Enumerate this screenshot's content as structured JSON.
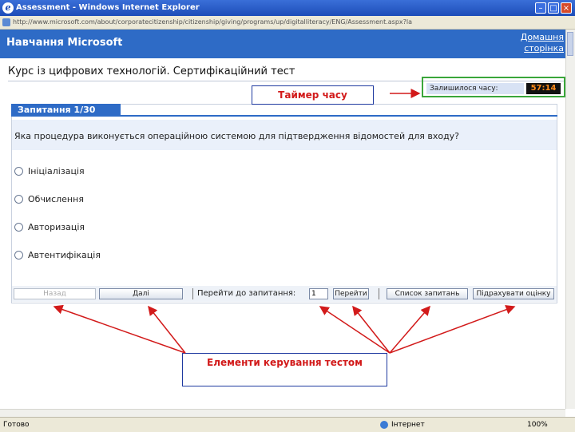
{
  "window": {
    "title": "Assessment - Windows Internet Explorer",
    "url": "http://www.microsoft.com/about/corporatecitizenship/citizenship/giving/programs/up/digitalliteracy/ENG/Assessment.aspx?lang=uk&ver=sesae"
  },
  "site": {
    "title": "Навчання Microsoft",
    "home_link": "Домашня сторінка"
  },
  "course": {
    "title": "Курс із цифрових технологій. Сертифікаційний тест"
  },
  "timer": {
    "label": "Залишилося часу:",
    "value": "57:14"
  },
  "question": {
    "header": "Запитання 1/30",
    "text": "Яка процедура виконується операційною системою для підтвердження відомостей для входу?",
    "answers": [
      "Ініціалізація",
      "Обчислення",
      "Авторизація",
      "Автентифікація"
    ]
  },
  "controls": {
    "back": "Назад",
    "next": "Далі",
    "goto_label": "Перейти до запитання:",
    "goto_value": "1",
    "goto_button": "Перейти",
    "list_button": "Список запитань",
    "score_button": "Підрахувати оцінку"
  },
  "callouts": {
    "timer": "Таймер часу",
    "controls": "Елементи керування тестом"
  },
  "status": {
    "left": "Готово",
    "zone": "Інтернет",
    "zoom": "100%"
  },
  "colors": {
    "header_blue": "#2e6bc6",
    "callout_red": "#d21a1a",
    "timer_orange": "#ff8a1a",
    "highlight_green": "#3aa63a"
  }
}
